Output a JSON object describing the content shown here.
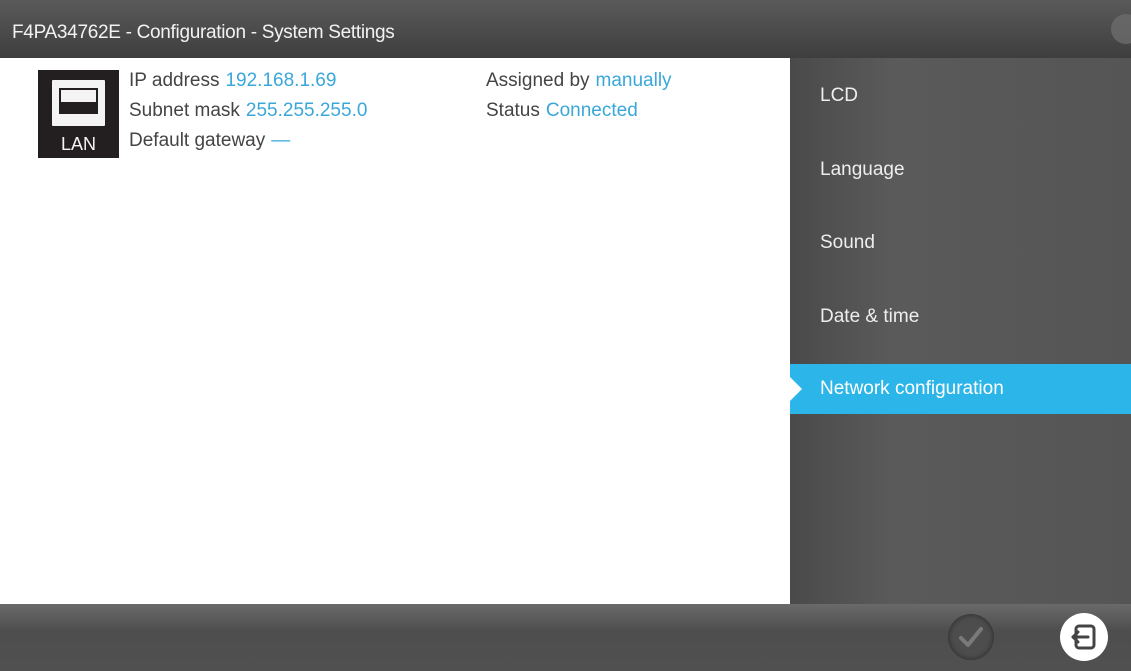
{
  "window": {
    "title": "F4PA34762E - Configuration - System Settings"
  },
  "network": {
    "icon_label": "LAN",
    "ip_label": "IP address",
    "ip_value": "192.168.1.69",
    "subnet_label": "Subnet mask",
    "subnet_value": "255.255.255.0",
    "gateway_label": "Default gateway",
    "gateway_value": "—",
    "assigned_label": "Assigned by",
    "assigned_value": "manually",
    "status_label": "Status",
    "status_value": "Connected"
  },
  "sidebar": {
    "items": [
      {
        "label": "LCD"
      },
      {
        "label": "Language"
      },
      {
        "label": "Sound"
      },
      {
        "label": "Date & time"
      },
      {
        "label": "Network configuration",
        "active": true
      }
    ]
  },
  "footer": {
    "confirm_icon": "checkmark-icon",
    "exit_icon": "exit-icon"
  },
  "colors": {
    "accent": "#2bb5e8",
    "value_text": "#3aa7d9",
    "bar_background": "#4a4a4a"
  }
}
